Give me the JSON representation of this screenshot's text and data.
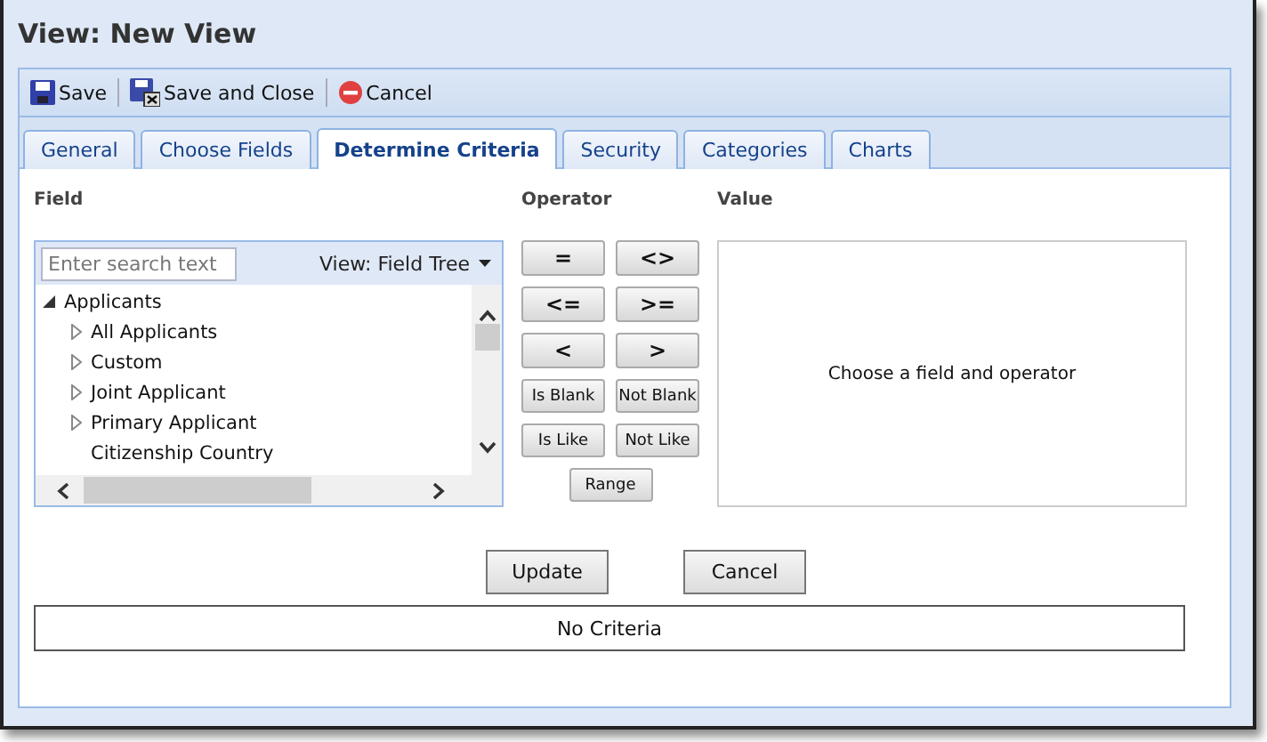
{
  "window": {
    "title": "View: New View"
  },
  "toolbar": [
    {
      "label": "Save",
      "kind": "save"
    },
    {
      "label": "Save and Close",
      "kind": "save-close"
    },
    {
      "label": "Cancel",
      "kind": "cancel"
    }
  ],
  "tabs": [
    {
      "label": "General",
      "selected": false
    },
    {
      "label": "Choose Fields",
      "selected": false
    },
    {
      "label": "Determine Criteria",
      "selected": true
    },
    {
      "label": "Security",
      "selected": false
    },
    {
      "label": "Categories",
      "selected": false
    },
    {
      "label": "Charts",
      "selected": false
    }
  ],
  "field": {
    "heading": "Field",
    "search": {
      "placeholder": "Enter search text"
    },
    "view_menu": "View: Field Tree",
    "tree": [
      {
        "label": "Applicants",
        "kind": "group",
        "expanded": true,
        "children": [
          {
            "label": "All Applicants",
            "kind": "folder"
          },
          {
            "label": "Custom",
            "kind": "folder"
          },
          {
            "label": "Joint Applicant",
            "kind": "folder"
          },
          {
            "label": "Primary Applicant",
            "kind": "folder"
          },
          {
            "label": "Citizenship Country",
            "kind": "field"
          }
        ]
      }
    ]
  },
  "operator": {
    "heading": "Operator",
    "buttons": [
      {
        "label": "=",
        "kind": "symbol"
      },
      {
        "label": "<>",
        "kind": "symbol"
      },
      {
        "label": "<=",
        "kind": "symbol"
      },
      {
        "label": ">=",
        "kind": "symbol"
      },
      {
        "label": "<",
        "kind": "symbol"
      },
      {
        "label": ">",
        "kind": "symbol"
      },
      {
        "label": "Is Blank",
        "kind": "word"
      },
      {
        "label": "Not Blank",
        "kind": "word"
      },
      {
        "label": "Is Like",
        "kind": "word"
      },
      {
        "label": "Not Like",
        "kind": "word"
      },
      {
        "label": "Range",
        "kind": "word"
      }
    ]
  },
  "value": {
    "heading": "Value",
    "message": "Choose a field and operator"
  },
  "actions": [
    "Update",
    "Cancel"
  ],
  "criteria": "No Criteria"
}
